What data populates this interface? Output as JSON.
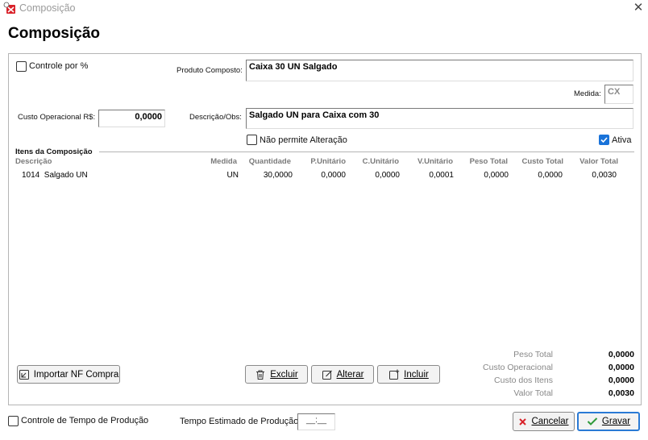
{
  "window": {
    "title": "Composição",
    "close_icon": "close-icon"
  },
  "page_title": "Composição",
  "form": {
    "controle_pct_label": "Controle por %",
    "produto_composto_label": "Produto Composto:",
    "produto_composto_value": "Caixa 30 UN Salgado",
    "medida_label": "Medida:",
    "medida_value": "CX",
    "custo_operacional_label": "Custo Operacional R$:",
    "custo_operacional_value": "0,0000",
    "descricao_label": "Descrição/Obs:",
    "descricao_value": "Salgado UN para Caixa com 30",
    "nao_permite_label": "Não permite Alteração",
    "ativa_label": "Ativa",
    "ativa_checked": true,
    "controle_pct_checked": false,
    "nao_permite_checked": false
  },
  "itens": {
    "section_title": "Itens da Composição",
    "headers": [
      "Descrição",
      "Medida",
      "Quantidade",
      "P.Unitário",
      "C.Unitário",
      "V.Unitário",
      "Peso Total",
      "Custo Total",
      "Valor Total"
    ],
    "rows": [
      [
        "1014  Salgado UN",
        "UN",
        "30,0000",
        "0,0000",
        "0,0000",
        "0,0001",
        "0,0000",
        "0,0000",
        "0,0030"
      ]
    ]
  },
  "buttons": {
    "importar": "Importar NF Compra",
    "excluir": "Excluir",
    "alterar": "Alterar",
    "incluir": "Incluir",
    "cancelar": "Cancelar",
    "gravar": "Gravar"
  },
  "totals": [
    {
      "label": "Peso Total",
      "value": "0,0000"
    },
    {
      "label": "Custo Operacional",
      "value": "0,0000"
    },
    {
      "label": "Custo dos Itens",
      "value": "0,0000"
    },
    {
      "label": "Valor Total",
      "value": "0,0030"
    }
  ],
  "footer": {
    "controle_tempo_label": "Controle de Tempo de Produção",
    "tempo_estimado_label": "Tempo Estimado de Produção",
    "tempo_value": "__:__"
  },
  "colors": {
    "accent": "#1a73d9",
    "cancel_red": "#d9222a",
    "confirm_green": "#2f9a3a",
    "gravar_border": "#2a7ad5"
  }
}
